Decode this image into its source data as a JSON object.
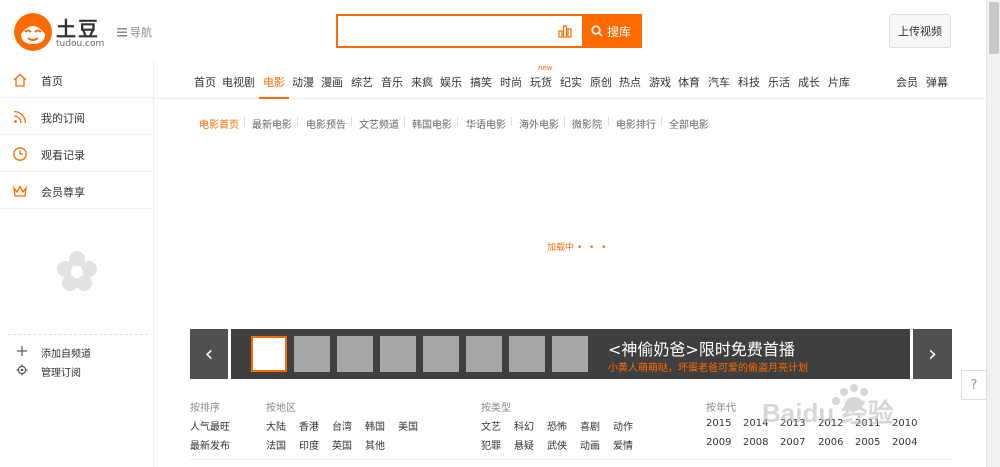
{
  "brand": {
    "name": "土豆",
    "domain": "tudou.com"
  },
  "header": {
    "nav_toggle_label": "导航",
    "search_placeholder": "",
    "search_button_label": "搜库",
    "upload_label": "上传视频"
  },
  "sidebar": {
    "items": [
      {
        "label": "首页",
        "icon": "home-icon"
      },
      {
        "label": "我的订阅",
        "icon": "rss-icon"
      },
      {
        "label": "观看记录",
        "icon": "clock-icon"
      },
      {
        "label": "会员尊享",
        "icon": "crown-icon"
      }
    ],
    "actions": [
      {
        "label": "添加自频道",
        "icon": "plus-icon"
      },
      {
        "label": "管理订阅",
        "icon": "gear-icon"
      }
    ]
  },
  "channels": {
    "items": [
      "首页",
      "电视剧",
      "电影",
      "动漫",
      "漫画",
      "综艺",
      "音乐",
      "来疯",
      "娱乐",
      "搞笑",
      "时尚",
      "玩货",
      "纪实",
      "原创",
      "热点",
      "游戏",
      "体育",
      "汽车",
      "科技",
      "乐活",
      "成长",
      "片库"
    ],
    "right_items": [
      "会员",
      "弹幕"
    ],
    "active": "电影",
    "new_badge": "new"
  },
  "subnav": {
    "items": [
      "电影首页",
      "最新电影",
      "电影预告",
      "文艺频道",
      "韩国电影",
      "华语电影",
      "海外电影",
      "微影院",
      "电影排行",
      "全部电影"
    ],
    "active": "电影首页"
  },
  "loading_text": "加载中",
  "banner": {
    "title": "<神偷奶爸>限时免费首播",
    "subtitle": "小黄人萌萌哒，坏蛋老爸可爱的偷盗月亮计划",
    "left_arrow": "‹",
    "right_arrow": "›",
    "thumbnail_count": 8
  },
  "filters": {
    "sort": {
      "heading": "按排序",
      "values": [
        "人气最旺",
        "最新发布"
      ]
    },
    "region": {
      "heading": "按地区",
      "row1": [
        "大陆",
        "香港",
        "台湾",
        "韩国",
        "美国"
      ],
      "row2": [
        "法国",
        "印度",
        "英国",
        "其他"
      ]
    },
    "genre": {
      "heading": "按类型",
      "row1": [
        "文艺",
        "科幻",
        "恐怖",
        "喜剧",
        "动作"
      ],
      "row2": [
        "犯罪",
        "悬疑",
        "武侠",
        "动画",
        "爱情"
      ]
    },
    "year": {
      "heading": "按年代",
      "row1": [
        "2015",
        "2014",
        "2013",
        "2012",
        "2011",
        "2010"
      ],
      "row2": [
        "2009",
        "2008",
        "2007",
        "2006",
        "2005",
        "2004"
      ]
    }
  },
  "help_label": "?",
  "watermark": "Baidu 经验",
  "colors": {
    "accent": "#ff6a00",
    "banner_bg": "#3f3f3f"
  }
}
